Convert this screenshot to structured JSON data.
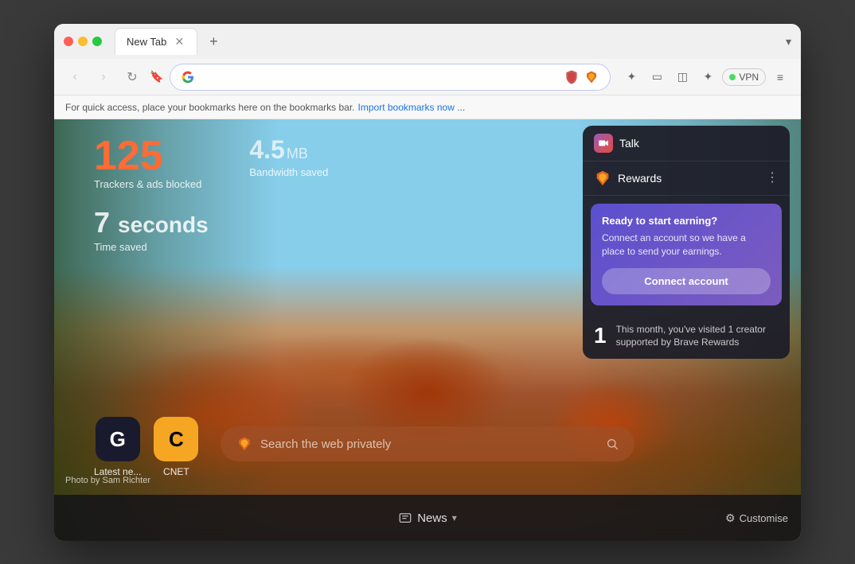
{
  "browser": {
    "window_title": "New Tab",
    "tab_label": "New Tab"
  },
  "nav": {
    "back_disabled": true,
    "forward_disabled": true,
    "address": "",
    "address_placeholder": "",
    "vpn_label": "VPN"
  },
  "bookmarks_bar": {
    "text": "For quick access, place your bookmarks here on the bookmarks bar.",
    "link_text": "Import bookmarks now ..."
  },
  "stats": {
    "trackers_count": "125",
    "trackers_label": "Trackers & ads blocked",
    "bandwidth_amount": "4.5",
    "bandwidth_unit": "MB",
    "bandwidth_label": "Bandwidth saved",
    "time_amount": "7",
    "time_unit": "seconds",
    "time_label": "Time saved"
  },
  "shortcuts": [
    {
      "label": "Latest ne...",
      "icon": "G",
      "style": "guardian"
    },
    {
      "label": "CNET",
      "icon": "C",
      "style": "cnet"
    }
  ],
  "search": {
    "placeholder": "Search the web privately"
  },
  "talk": {
    "label": "Talk"
  },
  "rewards": {
    "title": "Rewards",
    "card_title": "Ready to start earning?",
    "card_desc": "Connect an account so we have a place to send your earnings.",
    "connect_btn": "Connect account",
    "creator_num": "1",
    "creator_text": "This month, you've visited 1 creator supported by Brave Rewards"
  },
  "bottom": {
    "news_label": "News",
    "customise_label": "Customise"
  },
  "photo": {
    "credit": "Photo by Sam Richter"
  }
}
